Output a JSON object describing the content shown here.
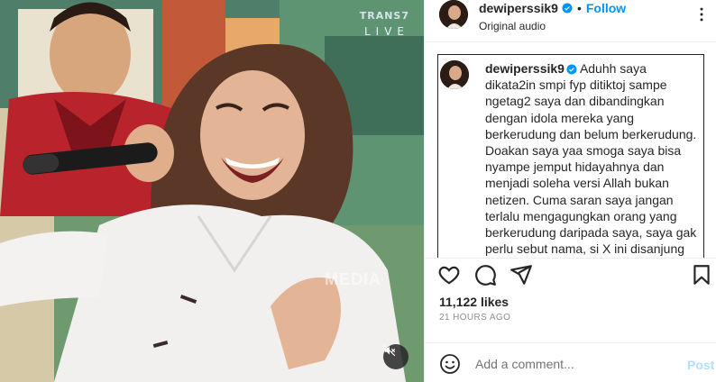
{
  "video": {
    "channel_logo_top": "TRANS7",
    "channel_logo_bottom": "LIVE",
    "watermark": "MEDIA",
    "mute_icon": "speaker-muted-icon"
  },
  "header": {
    "username": "dewiperssik9",
    "separator": "•",
    "follow_label": "Follow",
    "audio_label": "Original audio",
    "more_icon": "more-options-icon"
  },
  "caption": {
    "username": "dewiperssik9",
    "text": "Aduhh saya dikata2in smpi fyp ditiktoj sampe ngetag2 saya dan dibandingkan dengan idola mereka yang berkerudung dan belum berkerudung. Doakan saya yaa smoga saya bisa nyampe jemput hidayahnya dan menjadi soleha versi Allah bukan netizen. Cuma saran saya jangan terlalu mengagungkan orang yang berkerudung daripada saya, saya gak perlu sebut nama, si X ini disanjung setengah mati karena suaranya bagus"
  },
  "actions": {
    "icons": [
      "heart-icon",
      "comment-icon",
      "share-icon",
      "bookmark-icon"
    ]
  },
  "likes": "11,122 likes",
  "timestamp": "21 HOURS AGO",
  "comment": {
    "placeholder": "Add a comment...",
    "post_label": "Post"
  },
  "colors": {
    "link_blue": "#0095f6",
    "verified_blue": "#0095f6",
    "post_disabled": "#b2dffc",
    "muted_text": "#8e8e8e"
  }
}
